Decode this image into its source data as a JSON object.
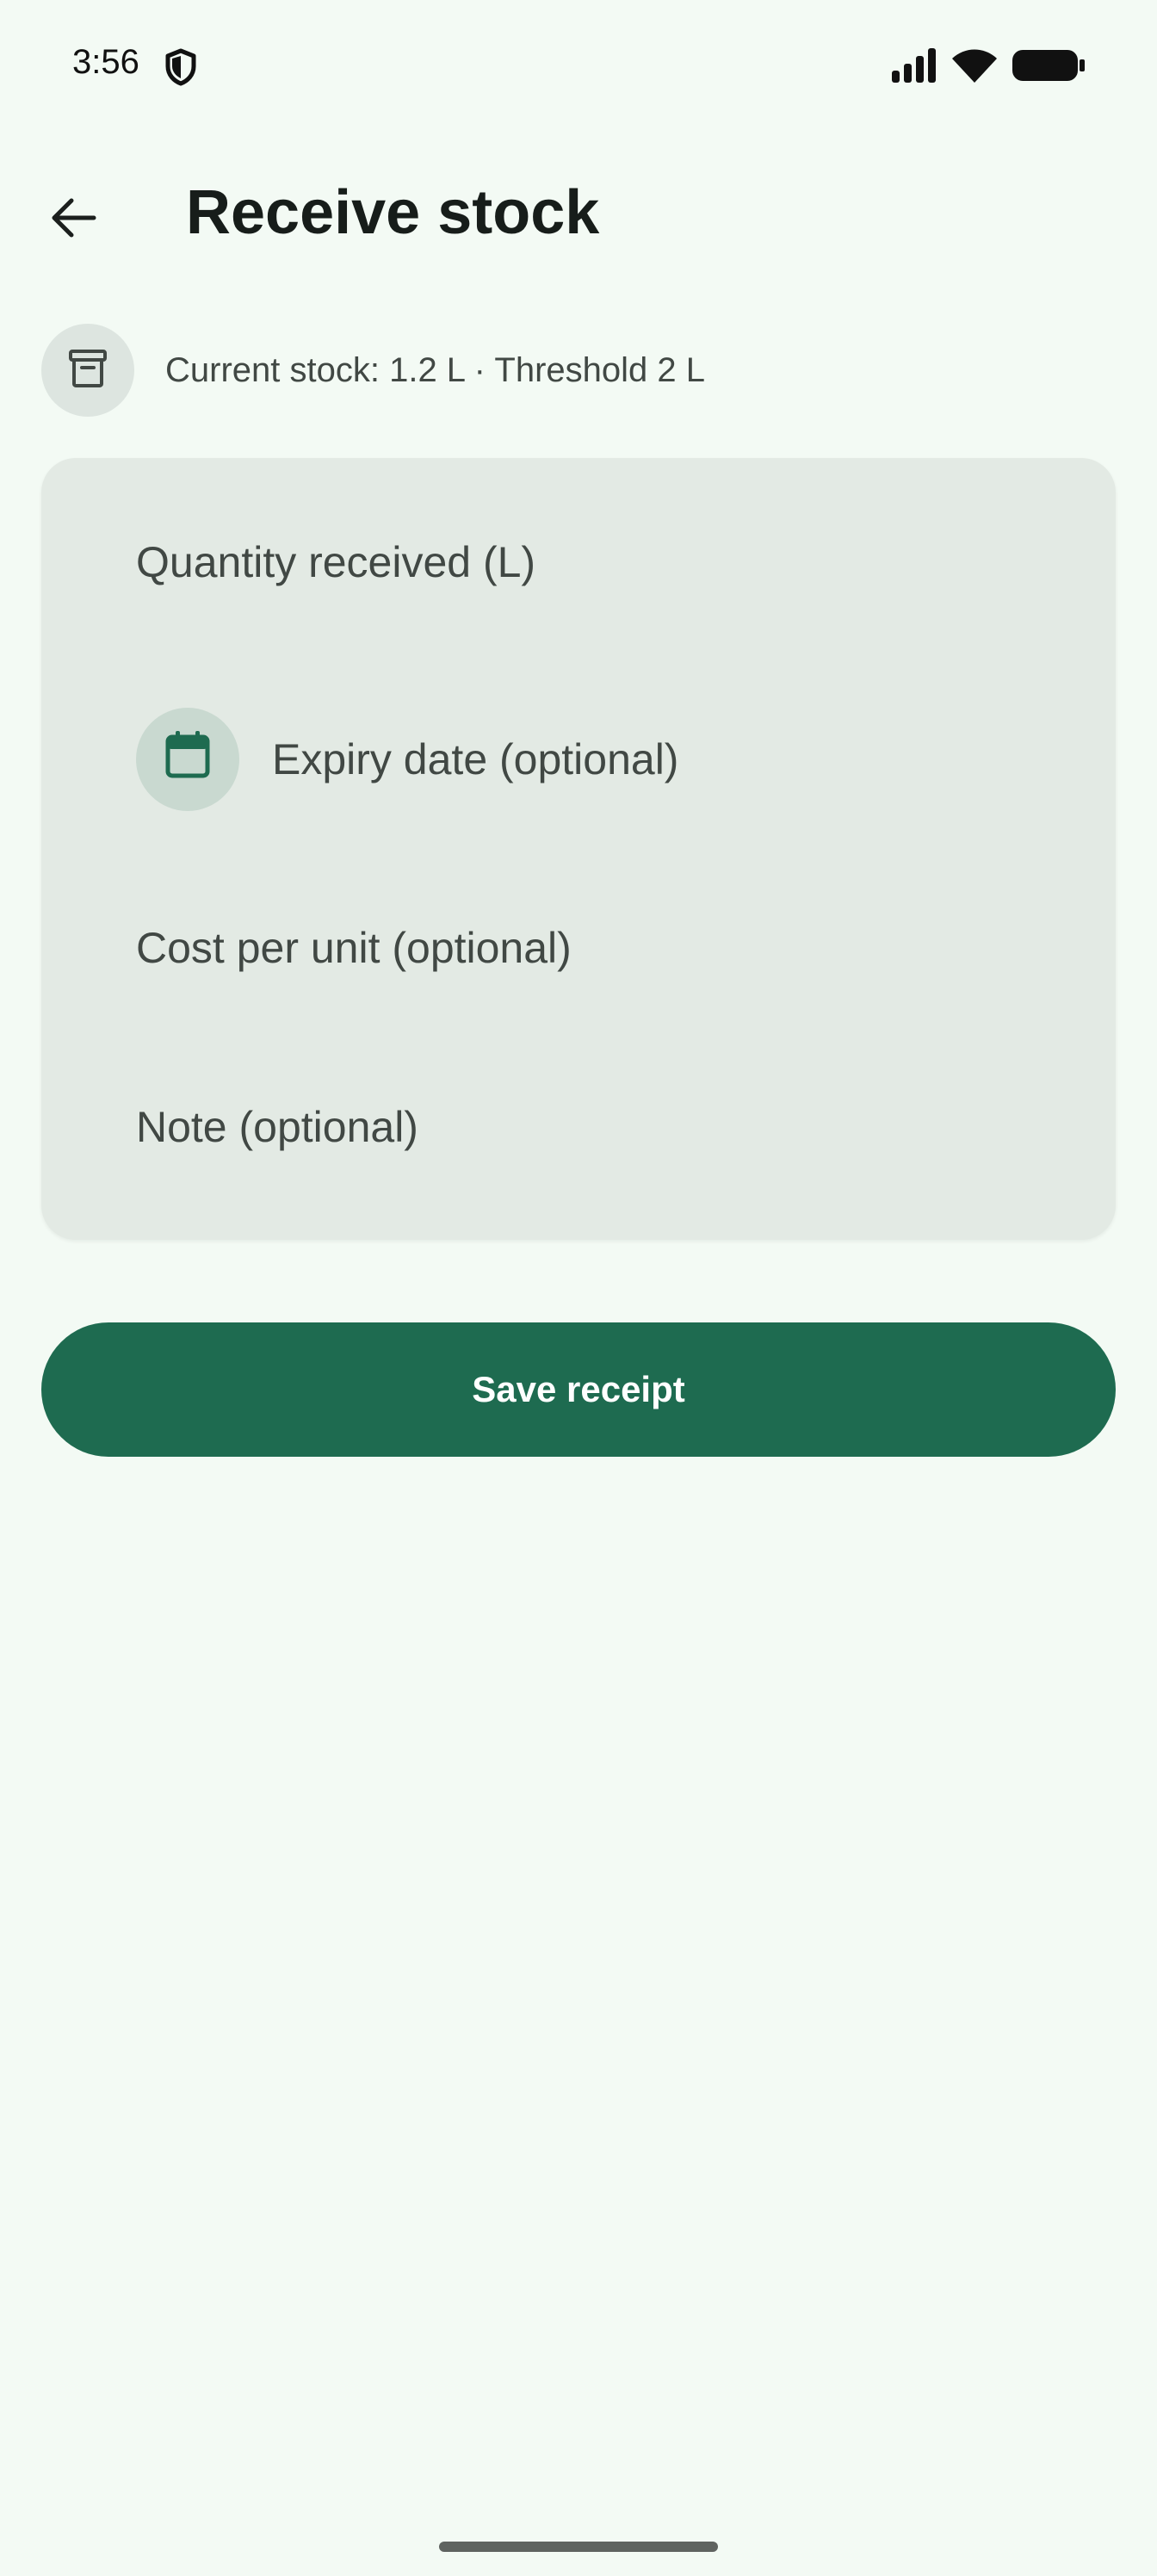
{
  "status_bar": {
    "time": "3:56"
  },
  "app_bar": {
    "title": "Receive stock"
  },
  "stock_info": {
    "text": "Current stock: 1.2 L · Threshold 2 L"
  },
  "form": {
    "quantity_label": "Quantity received (L)",
    "expiry_label": "Expiry date (optional)",
    "cost_label": "Cost per unit (optional)",
    "note_label": "Note (optional)"
  },
  "actions": {
    "save_label": "Save receipt"
  },
  "colors": {
    "background": "#f3faf4",
    "card": "#e3eae4",
    "primary": "#1e6b50",
    "icon_bg": "#c9d9d0"
  },
  "icons": {
    "back": "arrow-back-icon",
    "stock": "archive-box-icon",
    "expiry": "calendar-icon",
    "status_shield": "shield-icon",
    "signal": "signal-icon",
    "wifi": "wifi-icon",
    "battery": "battery-icon"
  }
}
